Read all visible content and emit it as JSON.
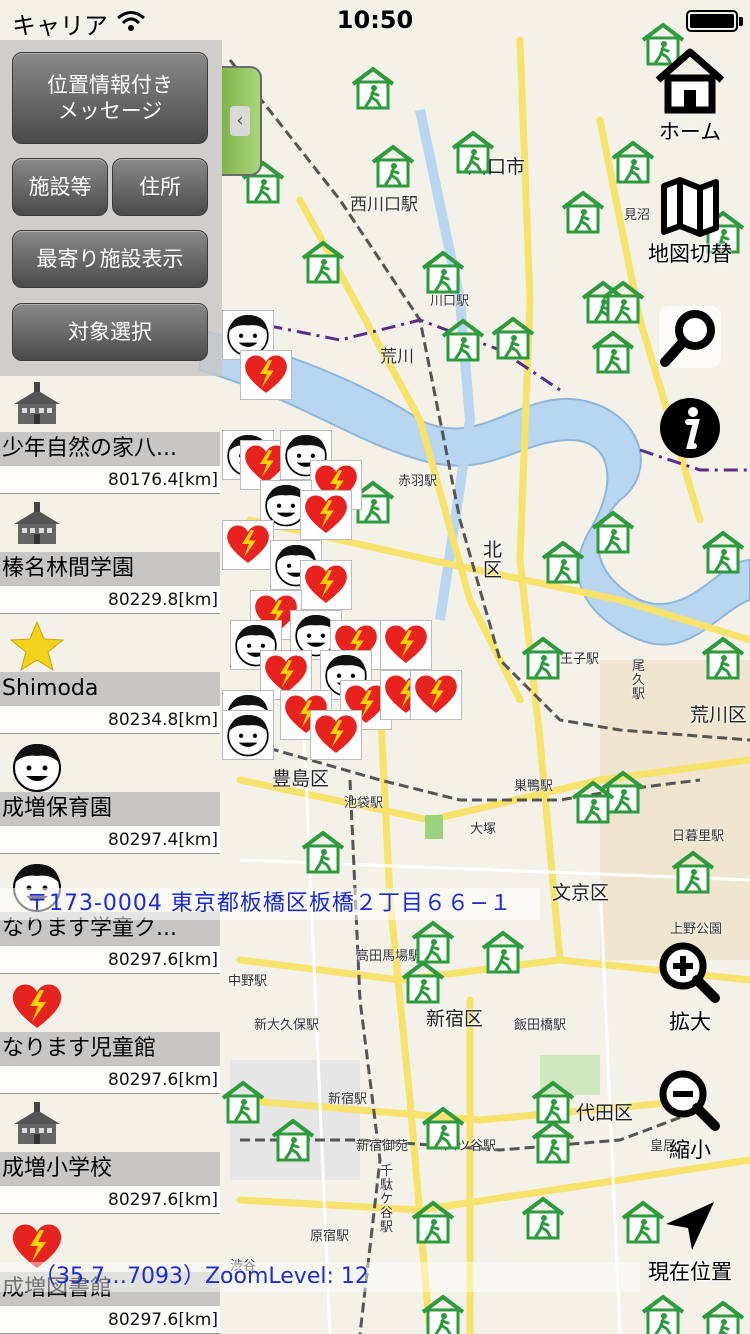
{
  "status_bar": {
    "carrier": "キャリア",
    "time": "10:50"
  },
  "left_panel": {
    "buttons": {
      "message": "位置情報付き\nメッセージ",
      "facility": "施設等",
      "address": "住所",
      "nearest": "最寄り施設表示",
      "target": "対象選択"
    },
    "facilities": [
      {
        "name": "少年自然の家八...",
        "distance": "80176.4[km]",
        "icon": "school-building-icon"
      },
      {
        "name": "榛名林間学園",
        "distance": "80229.8[km]",
        "icon": "school-building-icon"
      },
      {
        "name": "Shimoda",
        "distance": "80234.8[km]",
        "icon": "star-icon"
      },
      {
        "name": "成増保育園",
        "distance": "80297.4[km]",
        "icon": "child-face-icon"
      },
      {
        "name": "なります学童ク...",
        "distance": "80297.6[km]",
        "icon": "child-face-icon"
      },
      {
        "name": "なります児童館",
        "distance": "80297.6[km]",
        "icon": "heart-aed-icon"
      },
      {
        "name": "成増小学校",
        "distance": "80297.6[km]",
        "icon": "school-building-icon"
      },
      {
        "name": "成増図書館",
        "distance": "80297.6[km]",
        "icon": "heart-aed-icon"
      }
    ]
  },
  "right_toolbar": {
    "home": "ホーム",
    "map_switch": "地図切替",
    "zoom_in": "拡大",
    "zoom_out": "縮小",
    "current_location": "現在位置"
  },
  "overlays": {
    "address": "〒173-0004 東京都板橋区板橋２丁目６６−１",
    "coords": "（35.7…7093）ZoomLevel: 12"
  },
  "map_labels": [
    "西川口駅",
    "川口市",
    "見沼",
    "川口駅",
    "荒川",
    "赤羽駅",
    "北区",
    "王子駅",
    "荒川区",
    "豊島区",
    "池袋駅",
    "巣鴨駅",
    "文京区",
    "日暮里駅",
    "新宿区",
    "高田馬場駅",
    "飯田橋駅",
    "新宿駅",
    "代田区",
    "皇居",
    "原宿駅",
    "渋谷",
    "上野公園",
    "大塚",
    "中野駅",
    "新大久保駅",
    "四ツ谷駅",
    "新宿御苑",
    "千駄ケ谷駅",
    "尾久駅"
  ],
  "colors": {
    "shelter_green": "#2e9a3e",
    "address_text": "#1a2cd6",
    "map_background": "#f4f1e8",
    "river": "#b8d6f0",
    "road_yellow": "#f7e26b",
    "rail": "#555555"
  }
}
